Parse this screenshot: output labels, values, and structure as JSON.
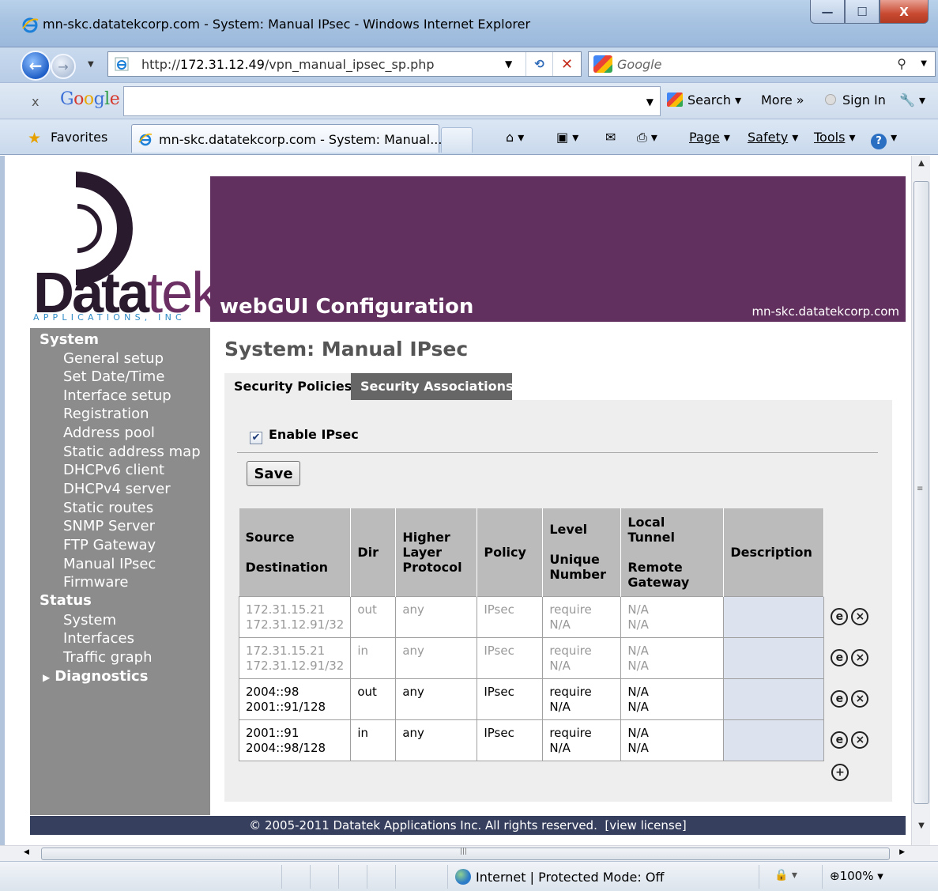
{
  "window": {
    "title": "mn-skc.datatekcorp.com - System: Manual IPsec - Windows Internet Explorer",
    "buttons": {
      "minimize": "—",
      "maximize": "☐",
      "close": "X"
    }
  },
  "address_bar": {
    "url_prefix": "http://",
    "url_host": "172.31.12.49",
    "url_path": "/vpn_manual_ipsec_sp.php",
    "search_placeholder": "Google"
  },
  "google_toolbar": {
    "close": "x",
    "logo": "Google",
    "search_label": "Search ▾",
    "more_label": "More »",
    "signin_label": "Sign In",
    "wrench": "🔧 ▾"
  },
  "favorites_bar": {
    "favorites_label": "Favorites",
    "tab_title": "mn-skc.datatekcorp.com - System: Manual...",
    "page_label": "Page",
    "safety_label": "Safety",
    "tools_label": "Tools",
    "help_label": "?"
  },
  "logo": {
    "word_bold": "Data",
    "word_thin": "tek",
    "sub": "APPLICATIONS, INC"
  },
  "banner": {
    "title": "webGUI Configuration",
    "hostname": "mn-skc.datatekcorp.com"
  },
  "sidebar": {
    "system_header": "System",
    "system_items": [
      "General setup",
      "Set Date/Time",
      "Interface setup",
      "Registration",
      "Address pool",
      "Static address map",
      "DHCPv6 client",
      "DHCPv4 server",
      "Static routes",
      "SNMP Server",
      "FTP Gateway",
      "Manual IPsec",
      "Firmware"
    ],
    "status_header": "Status",
    "status_items": [
      "System",
      "Interfaces",
      "Traffic graph"
    ],
    "diagnostics": "Diagnostics"
  },
  "page": {
    "title": "System: Manual IPsec",
    "tabs": [
      "Security Policies",
      "Security Associations"
    ],
    "enable_label": "Enable IPsec",
    "enable_checked": true,
    "save_label": "Save"
  },
  "table": {
    "headers": {
      "src_dst": [
        "Source",
        "Destination"
      ],
      "dir": "Dir",
      "proto": [
        "Higher",
        "Layer",
        "Protocol"
      ],
      "policy": "Policy",
      "level": [
        "Level",
        "Unique",
        "Number"
      ],
      "tunnel": [
        "Local",
        "Tunnel",
        "Remote",
        "Gateway"
      ],
      "description": "Description"
    },
    "rows": [
      {
        "source": "172.31.15.21",
        "destination": "172.31.12.91/32",
        "dir": "out",
        "proto": "any",
        "policy": "IPsec",
        "level": "require",
        "unique": "N/A",
        "local": "N/A",
        "remote": "N/A",
        "description": "",
        "disabled": true
      },
      {
        "source": "172.31.15.21",
        "destination": "172.31.12.91/32",
        "dir": "in",
        "proto": "any",
        "policy": "IPsec",
        "level": "require",
        "unique": "N/A",
        "local": "N/A",
        "remote": "N/A",
        "description": "",
        "disabled": true
      },
      {
        "source": "2004::98",
        "destination": "2001::91/128",
        "dir": "out",
        "proto": "any",
        "policy": "IPsec",
        "level": "require",
        "unique": "N/A",
        "local": "N/A",
        "remote": "N/A",
        "description": "",
        "disabled": false
      },
      {
        "source": "2001::91",
        "destination": "2004::98/128",
        "dir": "in",
        "proto": "any",
        "policy": "IPsec",
        "level": "require",
        "unique": "N/A",
        "local": "N/A",
        "remote": "N/A",
        "description": "",
        "disabled": false
      }
    ],
    "edit_glyph": "e",
    "delete_glyph": "×",
    "add_glyph": "+"
  },
  "footer": {
    "text": "© 2005-2011 Datatek Applications Inc. All rights reserved.",
    "link": "[view license]"
  },
  "status_bar": {
    "zone": "Internet | Protected Mode: Off",
    "zoom": "100%"
  }
}
